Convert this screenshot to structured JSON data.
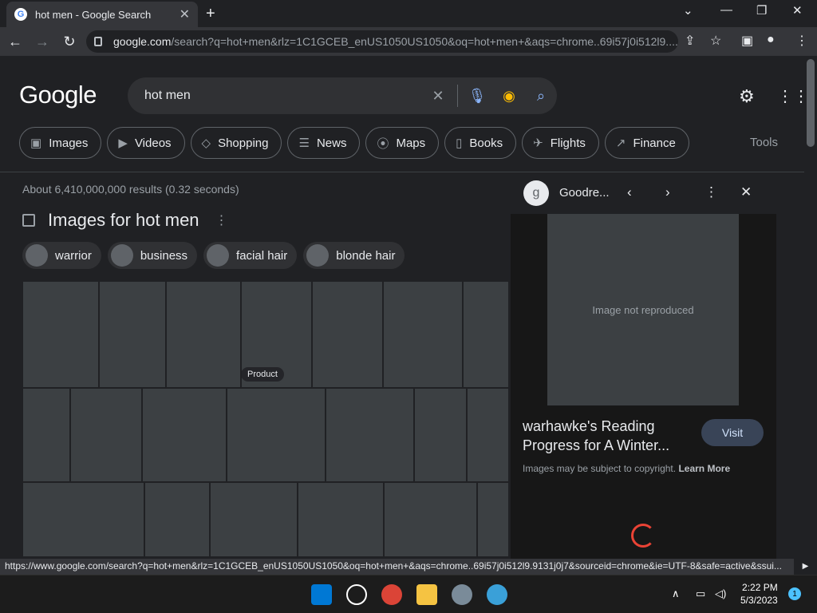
{
  "browser": {
    "tab_title": "hot men - Google Search",
    "tab_favicon": "G",
    "new_tab": "+",
    "url_host": "google.com",
    "url_path": "/search?q=hot+men&rlz=1C1GCEB_enUS1050US1050&oq=hot+men+&aqs=chrome..69i57j0i512l9....",
    "status_url": "https://www.google.com/search?q=hot+men&rlz=1C1GCEB_enUS1050US1050&oq=hot+men+&aqs=chrome..69i57j0i512l9.9131j0j7&sourceid=chrome&ie=UTF-8&safe=active&ssui..."
  },
  "google": {
    "logo": "Google",
    "query": "hot men",
    "tabs": [
      {
        "label": "Images",
        "icon": "image-icon",
        "glyph": "▣"
      },
      {
        "label": "Videos",
        "icon": "video-icon",
        "glyph": "▶"
      },
      {
        "label": "Shopping",
        "icon": "tag-icon",
        "glyph": "◇"
      },
      {
        "label": "News",
        "icon": "news-icon",
        "glyph": "☰"
      },
      {
        "label": "Maps",
        "icon": "pin-icon",
        "glyph": "⦿"
      },
      {
        "label": "Books",
        "icon": "book-icon",
        "glyph": "▯"
      },
      {
        "label": "Flights",
        "icon": "plane-icon",
        "glyph": "✈"
      },
      {
        "label": "Finance",
        "icon": "chart-icon",
        "glyph": "↗"
      }
    ],
    "tools": "Tools",
    "stats": "About 6,410,000,000 results (0.32 seconds)",
    "images_heading": "Images for hot men",
    "refinements": [
      "warrior",
      "business",
      "facial hair",
      "blonde hair"
    ],
    "product_label": "Product"
  },
  "panel": {
    "favicon": "g",
    "source": "Goodre...",
    "image_placeholder": "Image not reproduced",
    "title": "warhawke's Reading Progress for A Winter...",
    "visit": "Visit",
    "copyright": "Images may be subject to copyright.",
    "learn_more": "Learn More"
  },
  "taskbar": {
    "time": "2:22 PM",
    "date": "5/3/2023",
    "notifications": "1"
  },
  "colors": {
    "background": "#202124",
    "chrome_toolbar": "#35363a",
    "accent_link": "#8ab4f8",
    "spinner": "#ea4335"
  }
}
